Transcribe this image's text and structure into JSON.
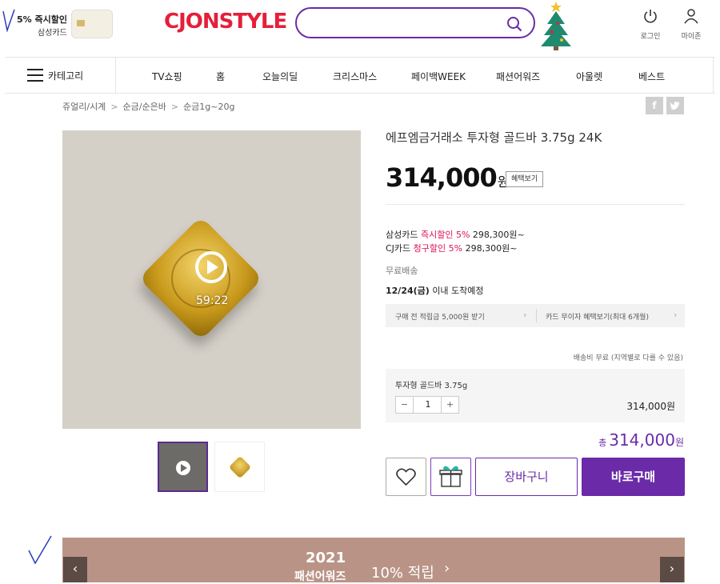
{
  "header": {
    "promo_line1": "5% 즉시할인",
    "promo_line2": "삼성카드",
    "logo_text": "CJ",
    "logo_text2": "ONSTYLE",
    "search_placeholder": "",
    "login_label": "로그인",
    "mypage_label": "마이존"
  },
  "nav": {
    "category_label": "카테고리",
    "items": [
      "TV쇼핑",
      "홈",
      "오늘의딜",
      "크리스마스",
      "페이백WEEK",
      "패션어워즈",
      "아울렛",
      "베스트"
    ]
  },
  "breadcrumb": [
    "쥬얼리/시계",
    "순금/순은바",
    "순금1g~20g"
  ],
  "sns": {
    "facebook": "f",
    "twitter": "t"
  },
  "media": {
    "video_time": "59:22"
  },
  "product": {
    "title": "에프엠금거래소 투자형 골드바 3.75g 24K",
    "price": "314,000",
    "currency": "원",
    "benefit_button": "혜택보기",
    "discounts": [
      {
        "card": "삼성카드",
        "label": "즉시할인 5%",
        "price": "298,300원~"
      },
      {
        "card": "CJ카드",
        "label": "청구할인 5%",
        "price": "298,300원~"
      }
    ],
    "shipping": "무료배송",
    "delivery_date": "12/24(금)",
    "delivery_suffix": "이내 도착예정",
    "benefit_1": "구매 전 적립금 5,000원 받기",
    "benefit_2": "카드 무이자 혜택보기(최대 6개월)",
    "ship_note": "배송비 무료 (지역별로 다를 수 있음)",
    "option_name": "투자형 골드바 3.75g",
    "quantity": "1",
    "minus": "−",
    "plus": "+",
    "option_price": "314,000원",
    "total_label": "총",
    "total_price": "314,000",
    "total_currency": "원",
    "cart_label": "장바구니",
    "buy_label": "바로구매"
  },
  "banner": {
    "year": "2021",
    "subtitle": "패션어워즈",
    "rate": "10% 적립",
    "arrow": "›",
    "prev": "‹",
    "next": "›"
  },
  "colors": {
    "brand_purple": "#6b2ba8",
    "logo_red": "#e41f3a",
    "discount_pink": "#e10f5a"
  }
}
